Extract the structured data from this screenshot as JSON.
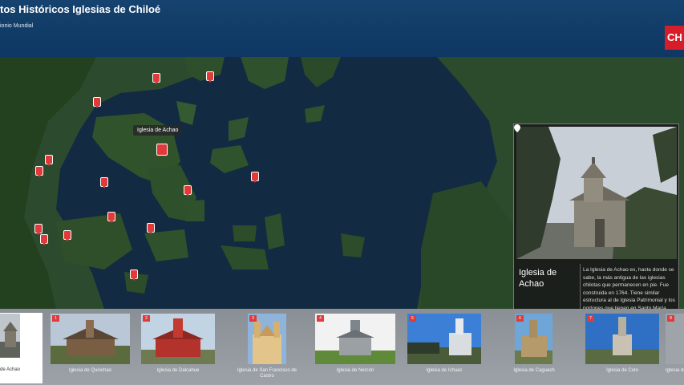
{
  "header": {
    "title": "tos Históricos Iglesias de Chiloé",
    "subtitle": "ionio Mundial",
    "logo_text": "CH"
  },
  "map": {
    "tooltip": "Iglesia de Achao",
    "markers": [
      "",
      "",
      "",
      "",
      "",
      "",
      "",
      "",
      "",
      "",
      "",
      "",
      "",
      "",
      "",
      "",
      ""
    ]
  },
  "panel": {
    "name": "Iglesia de Achao",
    "description": "La Iglesia de Achao es, hasta donde se sabe, la más antigua de las iglesias chilotas que permanecen en pie. Fue construida en 1764. Tiene similar estructura al de Iglesia Patrimonial y los portones que tienen en Santo María."
  },
  "thumbnails": [
    {
      "num": "1",
      "caption": "Iglesia de Quinchao"
    },
    {
      "num": "2",
      "caption": "Iglesia de Dalcahue"
    },
    {
      "num": "3",
      "caption": "Iglesia de San Francisco de Castro"
    },
    {
      "num": "4",
      "caption": "Iglesia de Nercón"
    },
    {
      "num": "5",
      "caption": "Iglesia de Ichuac"
    },
    {
      "num": "6",
      "caption": "Iglesia de Caguach"
    },
    {
      "num": "7",
      "caption": "Iglesia de Colo"
    },
    {
      "num": "8",
      "caption": "Iglesia de Aldachildo"
    }
  ],
  "active_thumb_caption": "de Achao",
  "colors": {
    "header": "#15426e",
    "marker": "#e03a3a",
    "logo": "#d71e28"
  }
}
